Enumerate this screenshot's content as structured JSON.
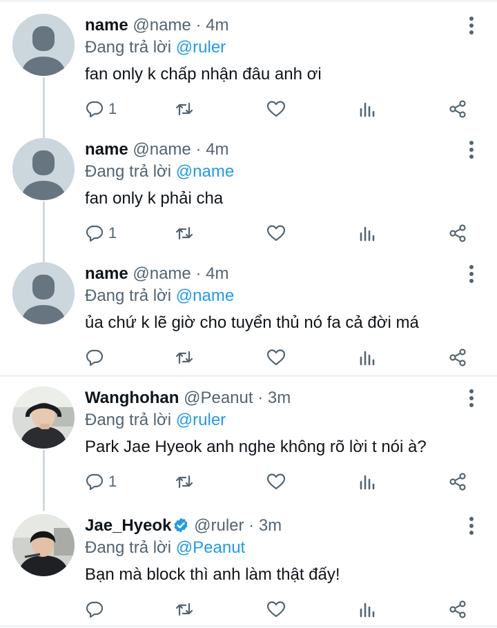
{
  "reply_prefix": "Đang trả lời",
  "dot": "·",
  "icons": {
    "reply": "reply-icon",
    "retweet": "retweet-icon",
    "like": "heart-icon",
    "analytics": "analytics-icon",
    "share": "share-icon",
    "more": "more-vertical-icon",
    "verified": "verified-badge-icon"
  },
  "colors": {
    "accent": "#1d9bf0",
    "muted": "#536471",
    "text": "#0f1419",
    "line": "#cfd9de"
  },
  "tweets": [
    {
      "name": "name",
      "handle": "@name",
      "time": "4m",
      "reply_to": "@ruler",
      "text": "fan only k chấp nhận đâu anh ơi",
      "reply_count": "1",
      "verified": false
    },
    {
      "name": "name",
      "handle": "@name",
      "time": "4m",
      "reply_to": "@name",
      "text": "fan only k phải cha",
      "reply_count": "1",
      "verified": false
    },
    {
      "name": "name",
      "handle": "@name",
      "time": "4m",
      "reply_to": "@name",
      "text": "ủa chứ k lẽ giờ cho tuyển thủ nó fa cả đời má",
      "reply_count": "",
      "verified": false
    },
    {
      "name": "Wanghohan",
      "handle": "@Peanut",
      "time": "3m",
      "reply_to": "@ruler",
      "text": "Park Jae Hyeok anh nghe không rõ lời t nói à?",
      "reply_count": "1",
      "verified": false
    },
    {
      "name": "Jae_Hyeok",
      "handle": "@ruler",
      "time": "3m",
      "reply_to": "@Peanut",
      "text": "Bạn mà block thì anh làm thật đấy!",
      "reply_count": "",
      "verified": true
    }
  ]
}
